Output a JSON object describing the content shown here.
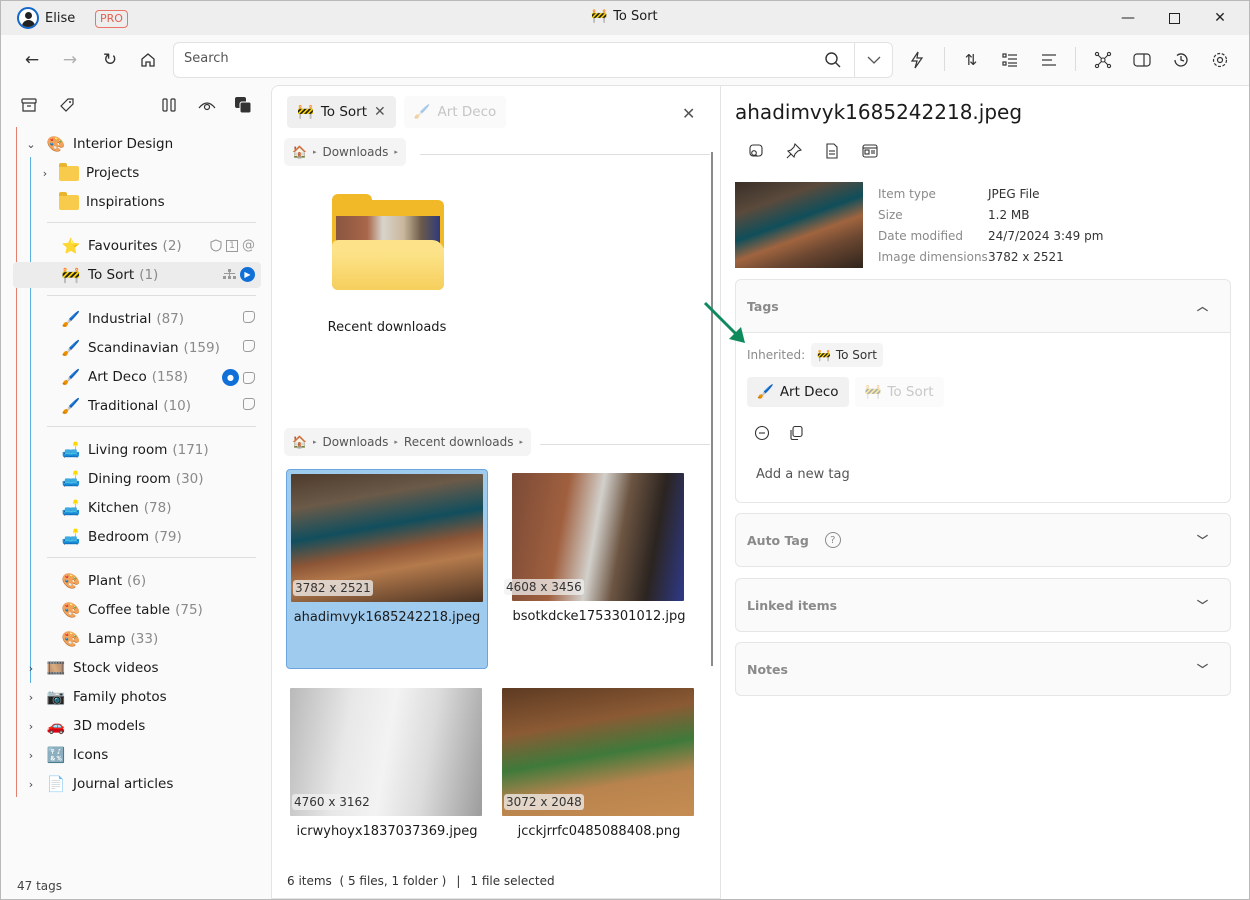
{
  "titlebar": {
    "user_name": "Elise",
    "plan_badge": "PRO",
    "window_title": "To Sort",
    "window_title_icon": "construction-barrier",
    "controls": [
      "minimize-icon",
      "maximize-icon",
      "close-icon"
    ]
  },
  "toolbar": {
    "nav": [
      "back-arrow-icon",
      "forward-arrow-icon",
      "refresh-icon",
      "home-icon"
    ],
    "search_placeholder": "Search",
    "search_value": "",
    "right_icons": [
      "lightning-icon",
      "sort-icon",
      "list-view-icon",
      "align-icon",
      "graph-icon",
      "panel-toggle-icon",
      "history-icon",
      "settings-icon"
    ]
  },
  "sidebar": {
    "top_icons": [
      "archive-icon",
      "tag-icon",
      "columns-icon",
      "eye-icon",
      "layers-icon"
    ],
    "root": {
      "label": "Interior Design",
      "icon": "🎨",
      "expanded": true
    },
    "folders": [
      {
        "label": "Projects",
        "expandable": true
      },
      {
        "label": "Inspirations",
        "expandable": false
      }
    ],
    "group1": [
      {
        "label": "Favourites",
        "count": "(2)",
        "icon": "⭐",
        "actions": [
          "shield-icon",
          "number-one-icon",
          "at-icon"
        ]
      },
      {
        "label": "To Sort",
        "count": "(1)",
        "icon": "🚧",
        "selected": true,
        "actions": [
          "hierarchy-icon",
          "location-pin-icon"
        ]
      }
    ],
    "group2": [
      {
        "label": "Industrial",
        "count": "(87)",
        "icon": "🖌️",
        "pin": false
      },
      {
        "label": "Scandinavian",
        "count": "(159)",
        "icon": "🖌️",
        "pin": false
      },
      {
        "label": "Art Deco",
        "count": "(158)",
        "icon": "🖌️",
        "pin": true
      },
      {
        "label": "Traditional",
        "count": "(10)",
        "icon": "🖌️",
        "pin": false
      }
    ],
    "group3": [
      {
        "label": "Living room",
        "count": "(171)",
        "icon": "🛋️"
      },
      {
        "label": "Dining room",
        "count": "(30)",
        "icon": "🛋️"
      },
      {
        "label": "Kitchen",
        "count": "(78)",
        "icon": "🛋️"
      },
      {
        "label": "Bedroom",
        "count": "(79)",
        "icon": "🛋️"
      }
    ],
    "group4": [
      {
        "label": "Plant",
        "count": "(6)",
        "icon": "🎨"
      },
      {
        "label": "Coffee table",
        "count": "(75)",
        "icon": "🎨"
      },
      {
        "label": "Lamp",
        "count": "(33)",
        "icon": "🎨"
      }
    ],
    "other_roots": [
      {
        "label": "Stock videos",
        "icon": "🎞️"
      },
      {
        "label": "Family photos",
        "icon": "📷"
      },
      {
        "label": "3D models",
        "icon": "🚗"
      },
      {
        "label": "Icons",
        "icon": "🔣"
      },
      {
        "label": "Journal articles",
        "icon": "📄"
      }
    ],
    "footer": "47 tags"
  },
  "middle": {
    "chips": [
      {
        "label": "To Sort",
        "icon": "🚧",
        "active": true
      },
      {
        "label": "Art Deco",
        "icon": "🖌️",
        "active": false
      }
    ],
    "breadcrumb1": [
      "Downloads"
    ],
    "folder": {
      "label": "Recent downloads"
    },
    "breadcrumb2": [
      "Downloads",
      "Recent downloads"
    ],
    "files": [
      {
        "name": "ahadimvyk1685242218.jpeg",
        "dims": "3782 x 2521",
        "selected": true
      },
      {
        "name": "bsotkdcke1753301012.jpg",
        "dims": "4608 x 3456",
        "selected": false
      },
      {
        "name": "icrwyhoyx1837037369.jpeg",
        "dims": "4760 x 3162",
        "selected": false
      },
      {
        "name": "jcckjrrfc0485088408.png",
        "dims": "3072 x 2048",
        "selected": false
      }
    ],
    "status": {
      "items": "6 items  ( 5 files, 1 folder )",
      "sep": "|",
      "selection": "1 file selected"
    }
  },
  "details": {
    "file_name": "ahadimvyk1685242218.jpeg",
    "action_icons": [
      "visual-search-icon",
      "pin-icon",
      "document-icon",
      "card-view-icon"
    ],
    "properties": [
      {
        "key": "Item type",
        "value": "JPEG File"
      },
      {
        "key": "Size",
        "value": "1.2 MB"
      },
      {
        "key": "Date modified",
        "value": "24/7/2024 3:49 pm"
      },
      {
        "key": "Image dimensions",
        "value": "3782 x 2521"
      }
    ],
    "tags": {
      "title": "Tags",
      "expanded": true,
      "inherited_label": "Inherited:",
      "inherited": [
        {
          "label": "To Sort",
          "icon": "🚧"
        }
      ],
      "assigned": [
        {
          "label": "Art Deco",
          "icon": "🖌️",
          "active": true
        },
        {
          "label": "To Sort",
          "icon": "🚧",
          "active": false
        }
      ],
      "add_placeholder": "Add a new tag"
    },
    "sections": [
      {
        "title": "Auto Tag",
        "help": true
      },
      {
        "title": "Linked items",
        "help": false
      },
      {
        "title": "Notes",
        "help": false
      }
    ]
  },
  "colors": {
    "accent_blue": "#1070d8",
    "selection": "#9fcbef",
    "pro_badge": "#e2604f",
    "tree_root_line": "#e4806f",
    "tree_child_line": "#5ab2e0",
    "annotation_arrow": "#0f8a5c"
  }
}
